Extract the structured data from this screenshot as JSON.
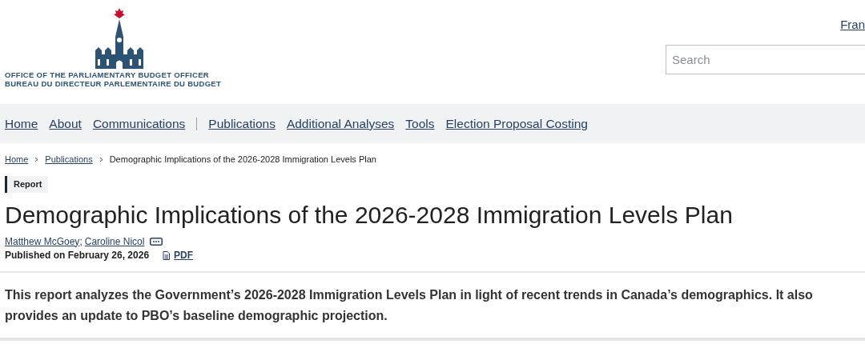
{
  "header": {
    "logo_lines": [
      "OFFICE OF THE PARLIAMENTARY BUDGET OFFICER",
      "BUREAU DU DIRECTEUR PARLEMENTAIRE DU BUDGET"
    ],
    "language_link": "Fran",
    "search": {
      "placeholder": "Search"
    }
  },
  "nav": {
    "groups": [
      [
        "Home",
        "About",
        "Communications"
      ],
      [
        "Publications",
        "Additional Analyses",
        "Tools",
        "Election Proposal Costing"
      ]
    ]
  },
  "breadcrumb": {
    "links": [
      "Home",
      "Publications"
    ],
    "current": "Demographic Implications of the 2026-2028 Immigration Levels Plan"
  },
  "badge": "Report",
  "title": "Demographic Implications of the 2026-2028 Immigration Levels Plan",
  "authors": [
    "Matthew McGoey",
    "Caroline Nicol"
  ],
  "author_separator": ";",
  "published": "Published on February 26, 2026",
  "pdf_link": "PDF",
  "summary": "This report analyzes the Government’s 2026-2028 Immigration Levels Plan in light of recent trends in Canada’s demographics. It also provides an update to PBO’s baseline demographic projection."
}
